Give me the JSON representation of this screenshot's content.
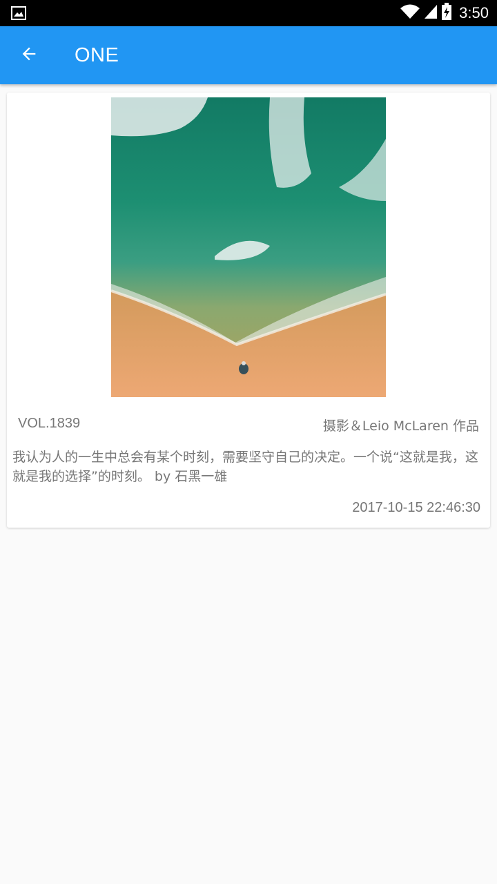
{
  "status_bar": {
    "time": "3:50",
    "icons": [
      "image-notification-icon",
      "wifi-icon",
      "cell-signal-icon",
      "battery-charging-icon"
    ]
  },
  "app_bar": {
    "title": "ONE",
    "back_icon": "arrow-back-icon"
  },
  "card": {
    "image_subject": "aerial view of ocean waves on sandy beach",
    "vol": "VOL.1839",
    "credit": "摄影＆Leio McLaren 作品",
    "quote": "我认为人的一生中总会有某个时刻，需要坚守自己的决定。一个说“这就是我，这就是我的选择”的时刻。 by 石黑一雄",
    "date": "2017-10-15 22:46:30"
  },
  "colors": {
    "primary": "#2196f3",
    "status_bar": "#000000",
    "background": "#fafafa",
    "card": "#ffffff",
    "text_secondary": "#777777"
  }
}
